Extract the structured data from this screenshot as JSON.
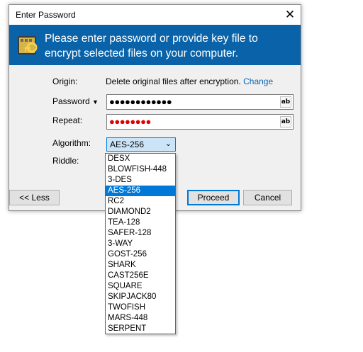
{
  "window": {
    "title": "Enter Password",
    "close_glyph": "✕"
  },
  "banner": {
    "icon": "key-folder-icon",
    "text": "Please enter password or provide key file to encrypt selected files on your computer."
  },
  "form": {
    "origin_label": "Origin:",
    "origin_value": "Delete original files after encryption.",
    "origin_link": "Change",
    "password_label": "Password",
    "password_value": "●●●●●●●●●●●●",
    "repeat_label": "Repeat:",
    "repeat_value": "●●●●●●●●",
    "ab_label": "ab",
    "algorithm_label": "Algorithm:",
    "algorithm_value": "AES-256",
    "riddle_label": "Riddle:"
  },
  "buttons": {
    "less": "<< Less",
    "proceed": "Proceed",
    "cancel": "Cancel"
  },
  "algorithms": {
    "selected": "AES-256",
    "options": [
      "DESX",
      "BLOWFISH-448",
      "3-DES",
      "AES-256",
      "RC2",
      "DIAMOND2",
      "TEA-128",
      "SAFER-128",
      "3-WAY",
      "GOST-256",
      "SHARK",
      "CAST256E",
      "SQUARE",
      "SKIPJACK80",
      "TWOFISH",
      "MARS-448",
      "SERPENT"
    ]
  },
  "colors": {
    "banner": "#0a63a8",
    "link": "#0b64b4",
    "selection": "#0078d7",
    "repeat_dots": "#e00000"
  }
}
